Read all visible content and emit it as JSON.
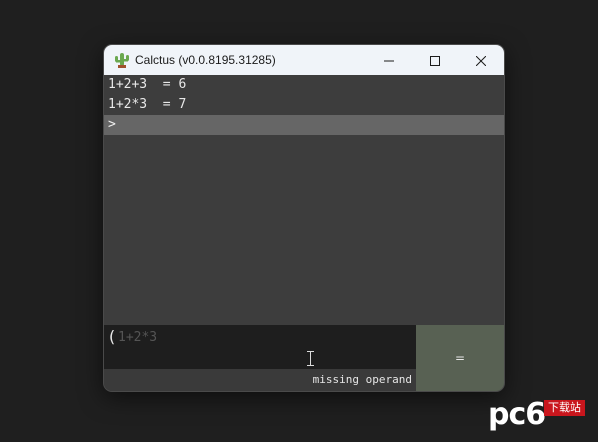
{
  "window": {
    "title": "Calctus (v0.0.8195.31285)",
    "icon": "cactus-icon",
    "controls": [
      "minimize-icon",
      "maximize-icon",
      "close-icon"
    ]
  },
  "history": [
    {
      "text": "1+2+3  = 6"
    },
    {
      "text": "1+2*3  = 7"
    }
  ],
  "prompt": {
    "symbol": ">"
  },
  "input": {
    "open_paren": "(",
    "hint": "1+2*3"
  },
  "status": {
    "message": "missing operand"
  },
  "equals_button": {
    "label": "="
  },
  "watermark": {
    "brand": "pc6",
    "badge": "下载站"
  },
  "colors": {
    "desktop": "#1f1f1f",
    "titlebar": "#f0f4f9",
    "console_bg": "#3d3d3d",
    "prompt_bg": "#666666",
    "input_bg": "#1e1e1e",
    "equals_bg": "#586153",
    "cactus": "#6aa84f",
    "watermark_badge": "#c9161d"
  }
}
